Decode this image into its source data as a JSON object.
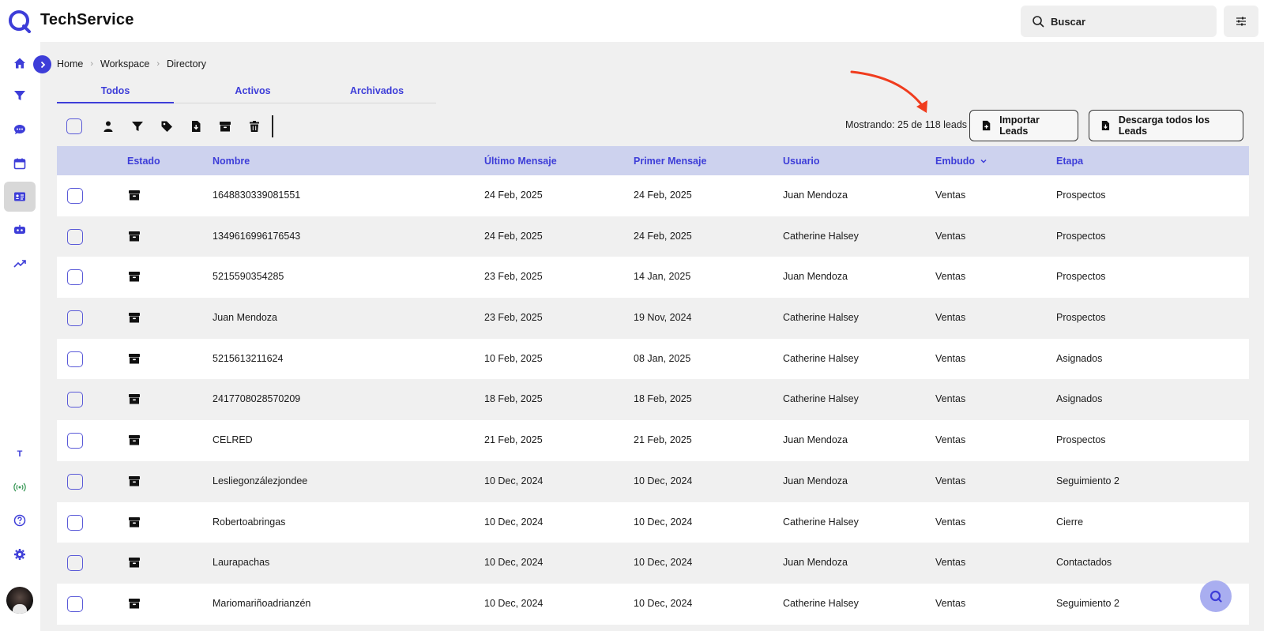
{
  "app": {
    "brand": "TechService"
  },
  "search": {
    "placeholder": "Buscar"
  },
  "breadcrumb": [
    "Home",
    "Workspace",
    "Directory"
  ],
  "tabs": [
    {
      "label": "Todos",
      "active": true
    },
    {
      "label": "Activos",
      "active": false
    },
    {
      "label": "Archivados",
      "active": false
    }
  ],
  "toolbar": {
    "icons": [
      "user-icon",
      "funnel-icon",
      "tag-icon",
      "download-file-icon",
      "archive-icon",
      "trash-icon"
    ]
  },
  "counter": {
    "text": "Mostrando: 25 de 118 leads"
  },
  "buttons": {
    "import": "Importar Leads",
    "download": "Descarga todos los Leads"
  },
  "sidebar": {
    "items": [
      "home-icon",
      "funnel-icon",
      "chat-icon",
      "calendar-icon",
      "contacts-icon",
      "bot-icon",
      "trending-icon"
    ],
    "bottom": {
      "t_label": "T"
    }
  },
  "table": {
    "columns": [
      "Estado",
      "Nombre",
      "Último Mensaje",
      "Primer Mensaje",
      "Usuario",
      "Embudo",
      "Etapa"
    ],
    "rows": [
      {
        "nombre": "1648830339081551",
        "ultimo": "24 Feb, 2025",
        "primer": "24 Feb, 2025",
        "usuario": "Juan Mendoza",
        "embudo": "Ventas",
        "etapa": "Prospectos"
      },
      {
        "nombre": "1349616996176543",
        "ultimo": "24 Feb, 2025",
        "primer": "24 Feb, 2025",
        "usuario": "Catherine Halsey",
        "embudo": "Ventas",
        "etapa": "Prospectos"
      },
      {
        "nombre": "5215590354285",
        "ultimo": "23 Feb, 2025",
        "primer": "14 Jan, 2025",
        "usuario": "Juan Mendoza",
        "embudo": "Ventas",
        "etapa": "Prospectos"
      },
      {
        "nombre": "Juan Mendoza",
        "ultimo": "23 Feb, 2025",
        "primer": "19 Nov, 2024",
        "usuario": "Catherine Halsey",
        "embudo": "Ventas",
        "etapa": "Prospectos"
      },
      {
        "nombre": "5215613211624",
        "ultimo": "10 Feb, 2025",
        "primer": "08 Jan, 2025",
        "usuario": "Catherine Halsey",
        "embudo": "Ventas",
        "etapa": "Asignados"
      },
      {
        "nombre": "2417708028570209",
        "ultimo": "18 Feb, 2025",
        "primer": "18 Feb, 2025",
        "usuario": "Catherine Halsey",
        "embudo": "Ventas",
        "etapa": "Asignados"
      },
      {
        "nombre": "CELRED",
        "ultimo": "21 Feb, 2025",
        "primer": "21 Feb, 2025",
        "usuario": "Juan Mendoza",
        "embudo": "Ventas",
        "etapa": "Prospectos"
      },
      {
        "nombre": "Lesliegonzálezjondee",
        "ultimo": "10 Dec, 2024",
        "primer": "10 Dec, 2024",
        "usuario": "Juan Mendoza",
        "embudo": "Ventas",
        "etapa": "Seguimiento 2"
      },
      {
        "nombre": "Robertoabringas",
        "ultimo": "10 Dec, 2024",
        "primer": "10 Dec, 2024",
        "usuario": "Catherine Halsey",
        "embudo": "Ventas",
        "etapa": "Cierre"
      },
      {
        "nombre": "Laurapachas",
        "ultimo": "10 Dec, 2024",
        "primer": "10 Dec, 2024",
        "usuario": "Juan Mendoza",
        "embudo": "Ventas",
        "etapa": "Contactados"
      },
      {
        "nombre": "Mariomariñoadrianzén",
        "ultimo": "10 Dec, 2024",
        "primer": "10 Dec, 2024",
        "usuario": "Catherine Halsey",
        "embudo": "Ventas",
        "etapa": "Seguimiento 2"
      }
    ]
  },
  "colors": {
    "accent": "#3d3dd8",
    "header_bg": "#cdd2ee",
    "annotation_arrow": "#f03c1e"
  }
}
